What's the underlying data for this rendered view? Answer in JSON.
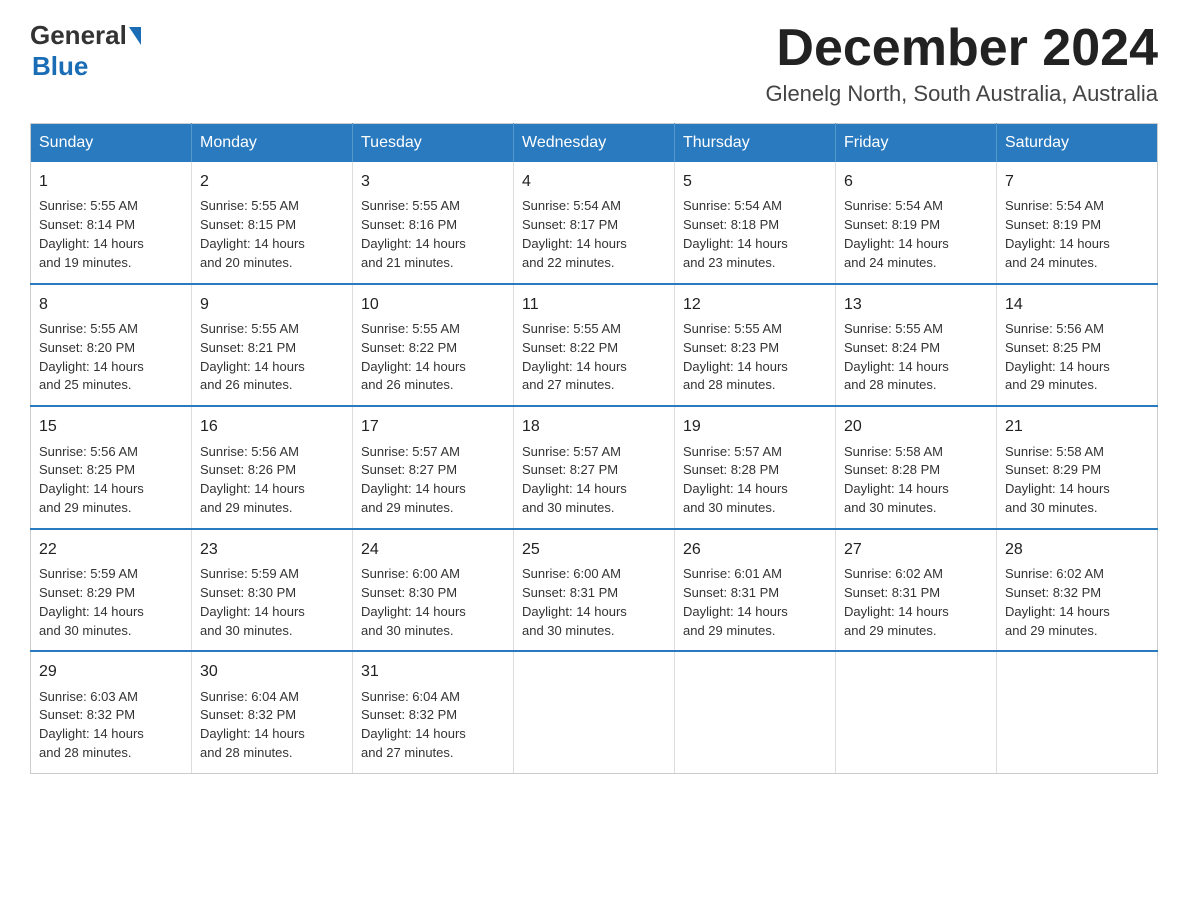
{
  "logo": {
    "general": "General",
    "blue": "Blue"
  },
  "title": "December 2024",
  "location": "Glenelg North, South Australia, Australia",
  "days_of_week": [
    "Sunday",
    "Monday",
    "Tuesday",
    "Wednesday",
    "Thursday",
    "Friday",
    "Saturday"
  ],
  "weeks": [
    [
      {
        "day": "1",
        "sunrise": "5:55 AM",
        "sunset": "8:14 PM",
        "daylight": "14 hours and 19 minutes."
      },
      {
        "day": "2",
        "sunrise": "5:55 AM",
        "sunset": "8:15 PM",
        "daylight": "14 hours and 20 minutes."
      },
      {
        "day": "3",
        "sunrise": "5:55 AM",
        "sunset": "8:16 PM",
        "daylight": "14 hours and 21 minutes."
      },
      {
        "day": "4",
        "sunrise": "5:54 AM",
        "sunset": "8:17 PM",
        "daylight": "14 hours and 22 minutes."
      },
      {
        "day": "5",
        "sunrise": "5:54 AM",
        "sunset": "8:18 PM",
        "daylight": "14 hours and 23 minutes."
      },
      {
        "day": "6",
        "sunrise": "5:54 AM",
        "sunset": "8:19 PM",
        "daylight": "14 hours and 24 minutes."
      },
      {
        "day": "7",
        "sunrise": "5:54 AM",
        "sunset": "8:19 PM",
        "daylight": "14 hours and 24 minutes."
      }
    ],
    [
      {
        "day": "8",
        "sunrise": "5:55 AM",
        "sunset": "8:20 PM",
        "daylight": "14 hours and 25 minutes."
      },
      {
        "day": "9",
        "sunrise": "5:55 AM",
        "sunset": "8:21 PM",
        "daylight": "14 hours and 26 minutes."
      },
      {
        "day": "10",
        "sunrise": "5:55 AM",
        "sunset": "8:22 PM",
        "daylight": "14 hours and 26 minutes."
      },
      {
        "day": "11",
        "sunrise": "5:55 AM",
        "sunset": "8:22 PM",
        "daylight": "14 hours and 27 minutes."
      },
      {
        "day": "12",
        "sunrise": "5:55 AM",
        "sunset": "8:23 PM",
        "daylight": "14 hours and 28 minutes."
      },
      {
        "day": "13",
        "sunrise": "5:55 AM",
        "sunset": "8:24 PM",
        "daylight": "14 hours and 28 minutes."
      },
      {
        "day": "14",
        "sunrise": "5:56 AM",
        "sunset": "8:25 PM",
        "daylight": "14 hours and 29 minutes."
      }
    ],
    [
      {
        "day": "15",
        "sunrise": "5:56 AM",
        "sunset": "8:25 PM",
        "daylight": "14 hours and 29 minutes."
      },
      {
        "day": "16",
        "sunrise": "5:56 AM",
        "sunset": "8:26 PM",
        "daylight": "14 hours and 29 minutes."
      },
      {
        "day": "17",
        "sunrise": "5:57 AM",
        "sunset": "8:27 PM",
        "daylight": "14 hours and 29 minutes."
      },
      {
        "day": "18",
        "sunrise": "5:57 AM",
        "sunset": "8:27 PM",
        "daylight": "14 hours and 30 minutes."
      },
      {
        "day": "19",
        "sunrise": "5:57 AM",
        "sunset": "8:28 PM",
        "daylight": "14 hours and 30 minutes."
      },
      {
        "day": "20",
        "sunrise": "5:58 AM",
        "sunset": "8:28 PM",
        "daylight": "14 hours and 30 minutes."
      },
      {
        "day": "21",
        "sunrise": "5:58 AM",
        "sunset": "8:29 PM",
        "daylight": "14 hours and 30 minutes."
      }
    ],
    [
      {
        "day": "22",
        "sunrise": "5:59 AM",
        "sunset": "8:29 PM",
        "daylight": "14 hours and 30 minutes."
      },
      {
        "day": "23",
        "sunrise": "5:59 AM",
        "sunset": "8:30 PM",
        "daylight": "14 hours and 30 minutes."
      },
      {
        "day": "24",
        "sunrise": "6:00 AM",
        "sunset": "8:30 PM",
        "daylight": "14 hours and 30 minutes."
      },
      {
        "day": "25",
        "sunrise": "6:00 AM",
        "sunset": "8:31 PM",
        "daylight": "14 hours and 30 minutes."
      },
      {
        "day": "26",
        "sunrise": "6:01 AM",
        "sunset": "8:31 PM",
        "daylight": "14 hours and 29 minutes."
      },
      {
        "day": "27",
        "sunrise": "6:02 AM",
        "sunset": "8:31 PM",
        "daylight": "14 hours and 29 minutes."
      },
      {
        "day": "28",
        "sunrise": "6:02 AM",
        "sunset": "8:32 PM",
        "daylight": "14 hours and 29 minutes."
      }
    ],
    [
      {
        "day": "29",
        "sunrise": "6:03 AM",
        "sunset": "8:32 PM",
        "daylight": "14 hours and 28 minutes."
      },
      {
        "day": "30",
        "sunrise": "6:04 AM",
        "sunset": "8:32 PM",
        "daylight": "14 hours and 28 minutes."
      },
      {
        "day": "31",
        "sunrise": "6:04 AM",
        "sunset": "8:32 PM",
        "daylight": "14 hours and 27 minutes."
      },
      null,
      null,
      null,
      null
    ]
  ],
  "labels": {
    "sunrise": "Sunrise:",
    "sunset": "Sunset:",
    "daylight": "Daylight:"
  }
}
